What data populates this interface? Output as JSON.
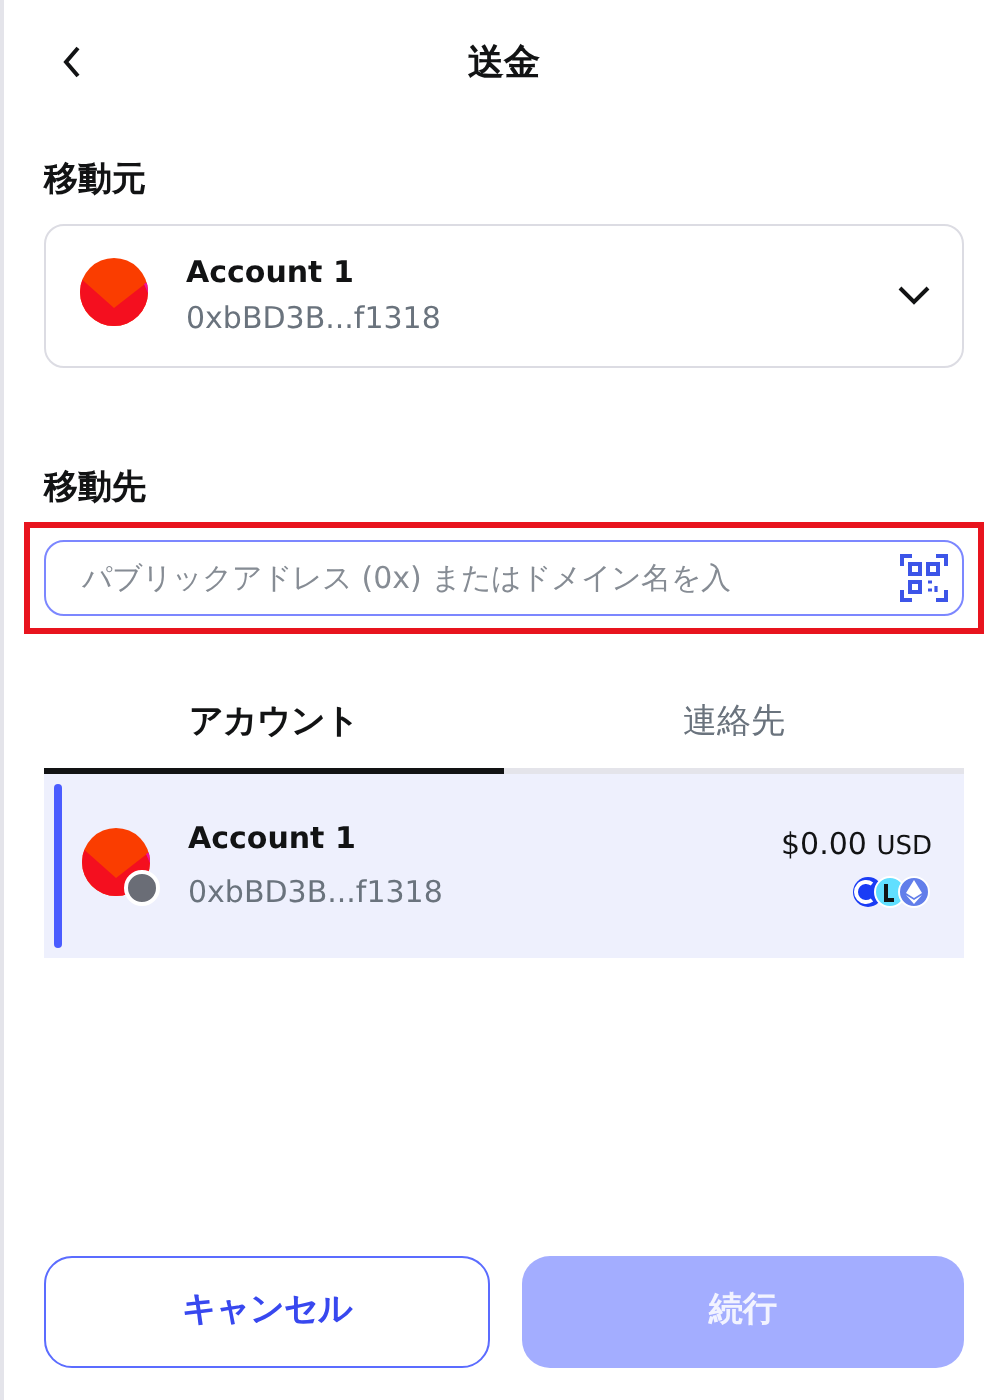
{
  "header": {
    "title": "送金"
  },
  "from": {
    "label": "移動元",
    "account": {
      "name": "Account 1",
      "address": "0xbBD3B...f1318"
    }
  },
  "to": {
    "label": "移動先",
    "placeholder": "パブリックアドレス (0x) またはドメイン名を入",
    "highlighted": true
  },
  "tabs": [
    {
      "label": "アカウント",
      "selected": true
    },
    {
      "label": "連絡先",
      "selected": false
    }
  ],
  "accounts": [
    {
      "name": "Account 1",
      "address": "0xbBD3B...f1318",
      "balance": "$0.00",
      "currency": "USD",
      "selected": true
    }
  ],
  "buttons": [
    {
      "label": "キャンセル",
      "kind": "secondary",
      "disabled": false
    },
    {
      "label": "続行",
      "kind": "primary",
      "disabled": true
    }
  ]
}
